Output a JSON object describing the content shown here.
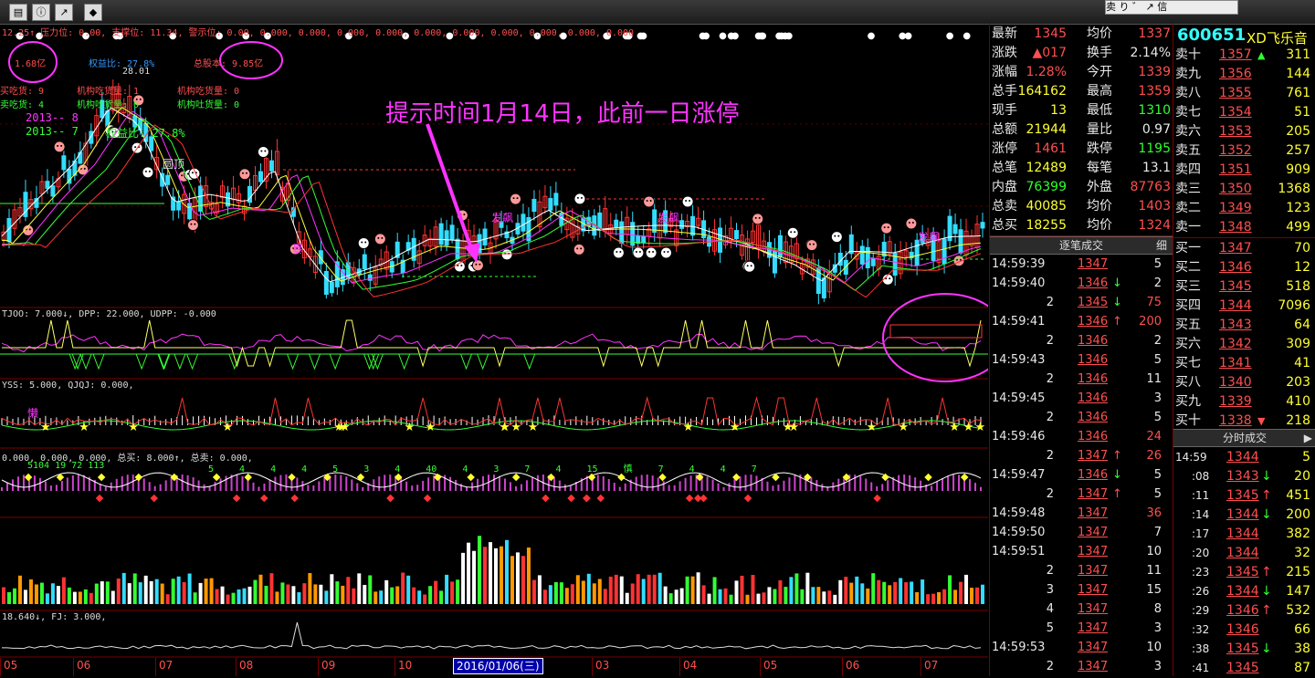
{
  "toolbar": {
    "right_text": "卖 り ゛ ↗ 信"
  },
  "main_indicator": {
    "line": "12.25↑ 压力位: 0.00, 支撑位: 11.34, 警示位: 0.00, 0.000, 0.000, 0.000, 0.000, 0.000, 0.000, 0.000, 0.000, 0.000, 0.000"
  },
  "overlay_left": {
    "l1": "1.68亿",
    "l1b": "权益比: 27.8%",
    "l1c": "总股本: 9.85亿",
    "l1d": "28.01",
    "l2": "买吃货: 9",
    "l2b": "机构吃货量: 1",
    "l2c": "机构吃货量: 0",
    "l3": "卖吃货: 4",
    "l3b": "机构吐货量: 0",
    "l3c": "机构吐货量: 0",
    "l4": "2013-- 8",
    "l5": "2013-- 7",
    "l5b": "权益比: 27.8%",
    "round_top": "圆顶"
  },
  "annotation": {
    "text": "提示时间1月14日，此前一日涨停"
  },
  "chart_labels": {
    "fafa1": "发飙",
    "fafa2": "发飙",
    "fafa3": "发飙",
    "bao": "暴",
    "lan": "懒"
  },
  "panel2": {
    "label": "TJOO: 7.000↓, DPP: 22.000, UDPP: -0.000"
  },
  "panel3": {
    "label": "YSS: 5.000, QJQJ: 0.000,"
  },
  "panel4": {
    "label": "0.000, 0.000, 0.000, 总买: 8.000↑, 总卖: 0.000,",
    "top_nums": "5104  19  72  113",
    "top_nums2": "5  4  4  4  5  3  4  40  4  3  7  4  15  慎  7  4  4  7"
  },
  "panel6": {
    "label": "18.640↓, FJ: 3.000,"
  },
  "date_axis": {
    "months": [
      "05",
      "06",
      "07",
      "08",
      "09",
      "10",
      "03",
      "04",
      "05",
      "06",
      "07"
    ],
    "selected": "2016/01/06(三)"
  },
  "stock": {
    "code": "600651",
    "name": "XD飞乐音"
  },
  "quote": [
    {
      "l1": "最新",
      "v1": "1345",
      "l2": "均价",
      "v2": "1337"
    },
    {
      "l1": "涨跌",
      "v1": "▲017",
      "l2": "换手",
      "v2": "2.14%"
    },
    {
      "l1": "涨幅",
      "v1": "1.28%",
      "l2": "今开",
      "v2": "1339"
    },
    {
      "l1": "总手",
      "v1": "164162",
      "l2": "最高",
      "v2": "1359"
    },
    {
      "l1": "现手",
      "v1": "13",
      "l2": "最低",
      "v2": "1310"
    },
    {
      "l1": "总额",
      "v1": "21944",
      "l2": "量比",
      "v2": "0.97"
    },
    {
      "l1": "涨停",
      "v1": "1461",
      "l2": "跌停",
      "v2": "1195"
    },
    {
      "l1": "总笔",
      "v1": "12489",
      "l2": "每笔",
      "v2": "13.1"
    },
    {
      "l1": "内盘",
      "v1": "76399",
      "l2": "外盘",
      "v2": "87763"
    },
    {
      "l1": "总卖",
      "v1": "40085",
      "l2": "均价",
      "v2": "1403"
    },
    {
      "l1": "总买",
      "v1": "18255",
      "l2": "均价",
      "v2": "1324"
    }
  ],
  "ticks_header": "逐笔成交",
  "ticks_header_btn": "细",
  "ticks": [
    {
      "t": "14:59:39",
      "p": "1347",
      "a": "",
      "v": "5"
    },
    {
      "t": "14:59:40",
      "p": "1346",
      "a": "↓",
      "v": "2"
    },
    {
      "t": "2",
      "p": "1345",
      "a": "↓",
      "v": "75"
    },
    {
      "t": "14:59:41",
      "p": "1346",
      "a": "↑",
      "v": "200"
    },
    {
      "t": "2",
      "p": "1346",
      "a": "",
      "v": "2"
    },
    {
      "t": "14:59:43",
      "p": "1346",
      "a": "",
      "v": "5"
    },
    {
      "t": "2",
      "p": "1346",
      "a": "",
      "v": "11"
    },
    {
      "t": "14:59:45",
      "p": "1346",
      "a": "",
      "v": "3"
    },
    {
      "t": "2",
      "p": "1346",
      "a": "",
      "v": "5"
    },
    {
      "t": "14:59:46",
      "p": "1346",
      "a": "",
      "v": "24"
    },
    {
      "t": "2",
      "p": "1347",
      "a": "↑",
      "v": "26"
    },
    {
      "t": "14:59:47",
      "p": "1346",
      "a": "↓",
      "v": "5"
    },
    {
      "t": "2",
      "p": "1347",
      "a": "↑",
      "v": "5"
    },
    {
      "t": "14:59:48",
      "p": "1347",
      "a": "",
      "v": "36"
    },
    {
      "t": "14:59:50",
      "p": "1347",
      "a": "",
      "v": "7"
    },
    {
      "t": "14:59:51",
      "p": "1347",
      "a": "",
      "v": "10"
    },
    {
      "t": "2",
      "p": "1347",
      "a": "",
      "v": "11"
    },
    {
      "t": "3",
      "p": "1347",
      "a": "",
      "v": "15"
    },
    {
      "t": "4",
      "p": "1347",
      "a": "",
      "v": "8"
    },
    {
      "t": "5",
      "p": "1347",
      "a": "",
      "v": "3"
    },
    {
      "t": "14:59:53",
      "p": "1347",
      "a": "",
      "v": "10"
    },
    {
      "t": "2",
      "p": "1347",
      "a": "",
      "v": "3"
    }
  ],
  "sell": [
    {
      "l": "卖十",
      "p": "1357",
      "a": "▲",
      "v": "311"
    },
    {
      "l": "卖九",
      "p": "1356",
      "a": "",
      "v": "144"
    },
    {
      "l": "卖八",
      "p": "1355",
      "a": "",
      "v": "761"
    },
    {
      "l": "卖七",
      "p": "1354",
      "a": "",
      "v": "51"
    },
    {
      "l": "卖六",
      "p": "1353",
      "a": "",
      "v": "205"
    },
    {
      "l": "卖五",
      "p": "1352",
      "a": "",
      "v": "257"
    },
    {
      "l": "卖四",
      "p": "1351",
      "a": "",
      "v": "909"
    },
    {
      "l": "卖三",
      "p": "1350",
      "a": "",
      "v": "1368"
    },
    {
      "l": "卖二",
      "p": "1349",
      "a": "",
      "v": "123"
    },
    {
      "l": "卖一",
      "p": "1348",
      "a": "",
      "v": "499"
    }
  ],
  "buy": [
    {
      "l": "买一",
      "p": "1347",
      "a": "",
      "v": "70"
    },
    {
      "l": "买二",
      "p": "1346",
      "a": "",
      "v": "12"
    },
    {
      "l": "买三",
      "p": "1345",
      "a": "",
      "v": "518"
    },
    {
      "l": "买四",
      "p": "1344",
      "a": "",
      "v": "7096"
    },
    {
      "l": "买五",
      "p": "1343",
      "a": "",
      "v": "64"
    },
    {
      "l": "买六",
      "p": "1342",
      "a": "",
      "v": "309"
    },
    {
      "l": "买七",
      "p": "1341",
      "a": "",
      "v": "41"
    },
    {
      "l": "买八",
      "p": "1340",
      "a": "",
      "v": "203"
    },
    {
      "l": "买九",
      "p": "1339",
      "a": "",
      "v": "410"
    },
    {
      "l": "买十",
      "p": "1338",
      "a": "▼",
      "v": "218"
    }
  ],
  "minute_header": "分时成交",
  "minute": [
    {
      "t": "14:59",
      "p": "1344",
      "a": "",
      "v": "5"
    },
    {
      "t": ":08",
      "p": "1343",
      "a": "↓",
      "v": "20"
    },
    {
      "t": ":11",
      "p": "1345",
      "a": "↑",
      "v": "451"
    },
    {
      "t": ":14",
      "p": "1344",
      "a": "↓",
      "v": "200"
    },
    {
      "t": ":17",
      "p": "1344",
      "a": "",
      "v": "382"
    },
    {
      "t": ":20",
      "p": "1344",
      "a": "",
      "v": "32"
    },
    {
      "t": ":23",
      "p": "1345",
      "a": "↑",
      "v": "215"
    },
    {
      "t": ":26",
      "p": "1344",
      "a": "↓",
      "v": "147"
    },
    {
      "t": ":29",
      "p": "1346",
      "a": "↑",
      "v": "532"
    },
    {
      "t": ":32",
      "p": "1346",
      "a": "",
      "v": "66"
    },
    {
      "t": ":38",
      "p": "1345",
      "a": "↓",
      "v": "38"
    },
    {
      "t": ":41",
      "p": "1345",
      "a": "",
      "v": "87"
    }
  ],
  "colors": {
    "up": "#ff4f4f",
    "down": "#2fff2f",
    "highlight": "#ff33ff",
    "accent": "#ffff33"
  }
}
